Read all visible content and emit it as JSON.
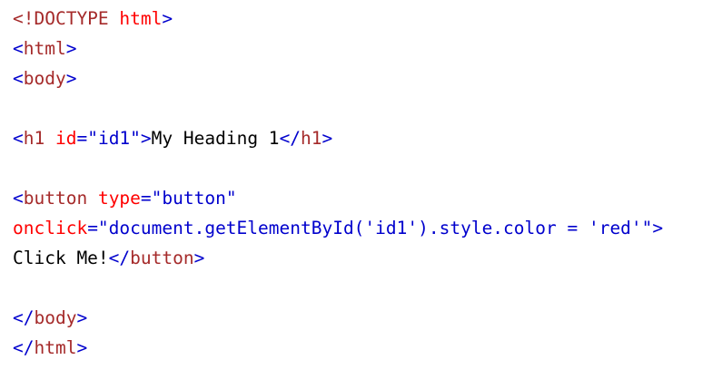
{
  "lines": [
    {
      "segments": [
        {
          "text": "<!DOCTYPE ",
          "cls": "c-doctype"
        },
        {
          "text": "html",
          "cls": "c-attr"
        },
        {
          "text": ">",
          "cls": "c-bracket"
        }
      ]
    },
    {
      "segments": [
        {
          "text": "<",
          "cls": "c-bracket"
        },
        {
          "text": "html",
          "cls": "c-tag"
        },
        {
          "text": ">",
          "cls": "c-bracket"
        }
      ]
    },
    {
      "segments": [
        {
          "text": "<",
          "cls": "c-bracket"
        },
        {
          "text": "body",
          "cls": "c-tag"
        },
        {
          "text": ">",
          "cls": "c-bracket"
        }
      ]
    },
    {
      "segments": []
    },
    {
      "segments": [
        {
          "text": "<",
          "cls": "c-bracket"
        },
        {
          "text": "h1",
          "cls": "c-tag"
        },
        {
          "text": " ",
          "cls": "c-text"
        },
        {
          "text": "id",
          "cls": "c-attr"
        },
        {
          "text": "=\"id1\"",
          "cls": "c-value"
        },
        {
          "text": ">",
          "cls": "c-bracket"
        },
        {
          "text": "My Heading 1",
          "cls": "c-text"
        },
        {
          "text": "</",
          "cls": "c-bracket"
        },
        {
          "text": "h1",
          "cls": "c-tag"
        },
        {
          "text": ">",
          "cls": "c-bracket"
        }
      ]
    },
    {
      "segments": []
    },
    {
      "segments": [
        {
          "text": "<",
          "cls": "c-bracket"
        },
        {
          "text": "button",
          "cls": "c-tag"
        },
        {
          "text": " ",
          "cls": "c-text"
        },
        {
          "text": "type",
          "cls": "c-attr"
        },
        {
          "text": "=\"button\"",
          "cls": "c-value"
        }
      ]
    },
    {
      "segments": [
        {
          "text": "onclick",
          "cls": "c-attr"
        },
        {
          "text": "=\"document.getElementById('id1').style.color = 'red'\"",
          "cls": "c-value"
        },
        {
          "text": ">",
          "cls": "c-bracket"
        }
      ]
    },
    {
      "segments": [
        {
          "text": "Click Me!",
          "cls": "c-text"
        },
        {
          "text": "</",
          "cls": "c-bracket"
        },
        {
          "text": "button",
          "cls": "c-tag"
        },
        {
          "text": ">",
          "cls": "c-bracket"
        }
      ]
    },
    {
      "segments": []
    },
    {
      "segments": [
        {
          "text": "</",
          "cls": "c-bracket"
        },
        {
          "text": "body",
          "cls": "c-tag"
        },
        {
          "text": ">",
          "cls": "c-bracket"
        }
      ]
    },
    {
      "segments": [
        {
          "text": "</",
          "cls": "c-bracket"
        },
        {
          "text": "html",
          "cls": "c-tag"
        },
        {
          "text": ">",
          "cls": "c-bracket"
        }
      ]
    }
  ]
}
